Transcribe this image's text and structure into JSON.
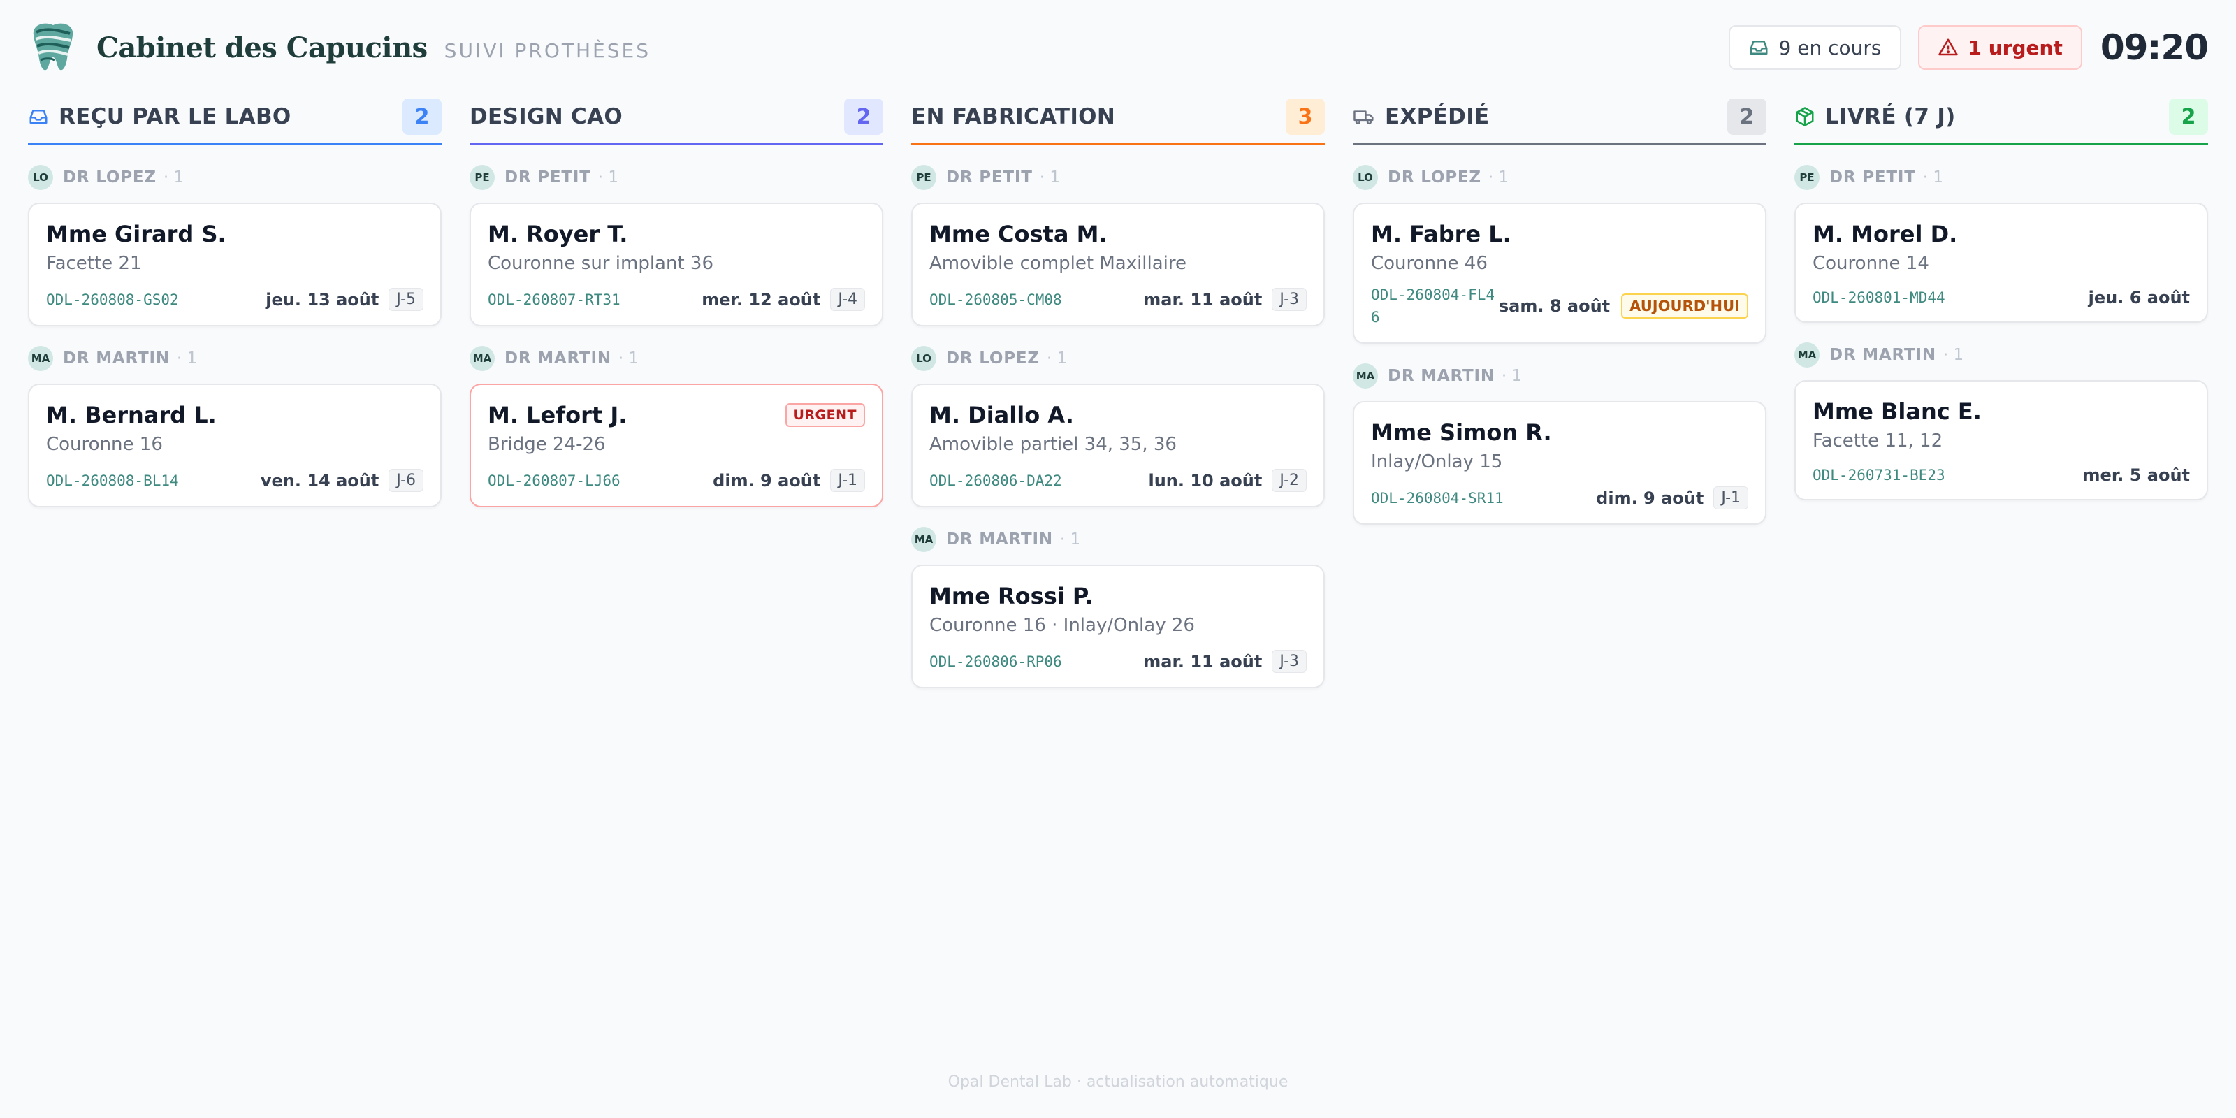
{
  "header": {
    "brand_name": "Cabinet des Capucins",
    "brand_subtitle": "SUIVI PROTHÈSES",
    "in_progress_label": "9 en cours",
    "urgent_label": "1 urgent",
    "clock": "09:20"
  },
  "columns": [
    {
      "title": "REÇU PAR LE LABO",
      "count": "2",
      "accent": "#3b82f6",
      "icon": "inbox-icon",
      "groups": [
        {
          "avatar": "LO",
          "doctor": "DR LOPEZ",
          "count": "· 1",
          "cards": [
            {
              "patient": "Mme Girard S.",
              "treatment": "Facette 21",
              "ref": "ODL-260808-GS02",
              "due": "jeu. 13 août",
              "j": "J-5"
            }
          ]
        },
        {
          "avatar": "MA",
          "doctor": "DR MARTIN",
          "count": "· 1",
          "cards": [
            {
              "patient": "M. Bernard L.",
              "treatment": "Couronne 16",
              "ref": "ODL-260808-BL14",
              "due": "ven. 14 août",
              "j": "J-6"
            }
          ]
        }
      ]
    },
    {
      "title": "DESIGN CAO",
      "count": "2",
      "accent": "#6366f1",
      "icon": "",
      "groups": [
        {
          "avatar": "PE",
          "doctor": "DR PETIT",
          "count": "· 1",
          "cards": [
            {
              "patient": "M. Royer T.",
              "treatment": "Couronne sur implant 36",
              "ref": "ODL-260807-RT31",
              "due": "mer. 12 août",
              "j": "J-4"
            }
          ]
        },
        {
          "avatar": "MA",
          "doctor": "DR MARTIN",
          "count": "· 1",
          "cards": [
            {
              "patient": "M. Lefort J.",
              "treatment": "Bridge 24-26",
              "ref": "ODL-260807-LJ66",
              "due": "dim. 9 août",
              "j": "J-1",
              "urgent": "URGENT"
            }
          ]
        }
      ]
    },
    {
      "title": "EN FABRICATION",
      "count": "3",
      "accent": "#f97316",
      "icon": "",
      "groups": [
        {
          "avatar": "PE",
          "doctor": "DR PETIT",
          "count": "· 1",
          "cards": [
            {
              "patient": "Mme Costa M.",
              "treatment": "Amovible complet Maxillaire",
              "ref": "ODL-260805-CM08",
              "due": "mar. 11 août",
              "j": "J-3"
            }
          ]
        },
        {
          "avatar": "LO",
          "doctor": "DR LOPEZ",
          "count": "· 1",
          "cards": [
            {
              "patient": "M. Diallo A.",
              "treatment": "Amovible partiel 34, 35, 36",
              "ref": "ODL-260806-DA22",
              "due": "lun. 10 août",
              "j": "J-2"
            }
          ]
        },
        {
          "avatar": "MA",
          "doctor": "DR MARTIN",
          "count": "· 1",
          "cards": [
            {
              "patient": "Mme Rossi P.",
              "treatment": "Couronne 16 · Inlay/Onlay 26",
              "ref": "ODL-260806-RP06",
              "due": "mar. 11 août",
              "j": "J-3"
            }
          ]
        }
      ]
    },
    {
      "title": "EXPÉDIÉ",
      "count": "2",
      "accent": "#6b7280",
      "icon": "truck-icon",
      "groups": [
        {
          "avatar": "LO",
          "doctor": "DR LOPEZ",
          "count": "· 1",
          "cards": [
            {
              "patient": "M. Fabre L.",
              "treatment": "Couronne 46",
              "ref": "ODL-260804-FL46",
              "due": "sam. 8 août",
              "today": "AUJOURD'HUI"
            }
          ]
        },
        {
          "avatar": "MA",
          "doctor": "DR MARTIN",
          "count": "· 1",
          "cards": [
            {
              "patient": "Mme Simon R.",
              "treatment": "Inlay/Onlay 15",
              "ref": "ODL-260804-SR11",
              "due": "dim. 9 août",
              "j": "J-1"
            }
          ]
        }
      ]
    },
    {
      "title": "LIVRÉ (7 J)",
      "count": "2",
      "accent": "#16a34a",
      "icon": "package-icon",
      "groups": [
        {
          "avatar": "PE",
          "doctor": "DR PETIT",
          "count": "· 1",
          "cards": [
            {
              "patient": "M. Morel D.",
              "treatment": "Couronne 14",
              "ref": "ODL-260801-MD44",
              "due": "jeu. 6 août"
            }
          ]
        },
        {
          "avatar": "MA",
          "doctor": "DR MARTIN",
          "count": "· 1",
          "cards": [
            {
              "patient": "Mme Blanc E.",
              "treatment": "Facette 11, 12",
              "ref": "ODL-260731-BE23",
              "due": "mer. 5 août"
            }
          ]
        }
      ]
    }
  ],
  "footer": "Opal Dental Lab · actualisation automatique"
}
